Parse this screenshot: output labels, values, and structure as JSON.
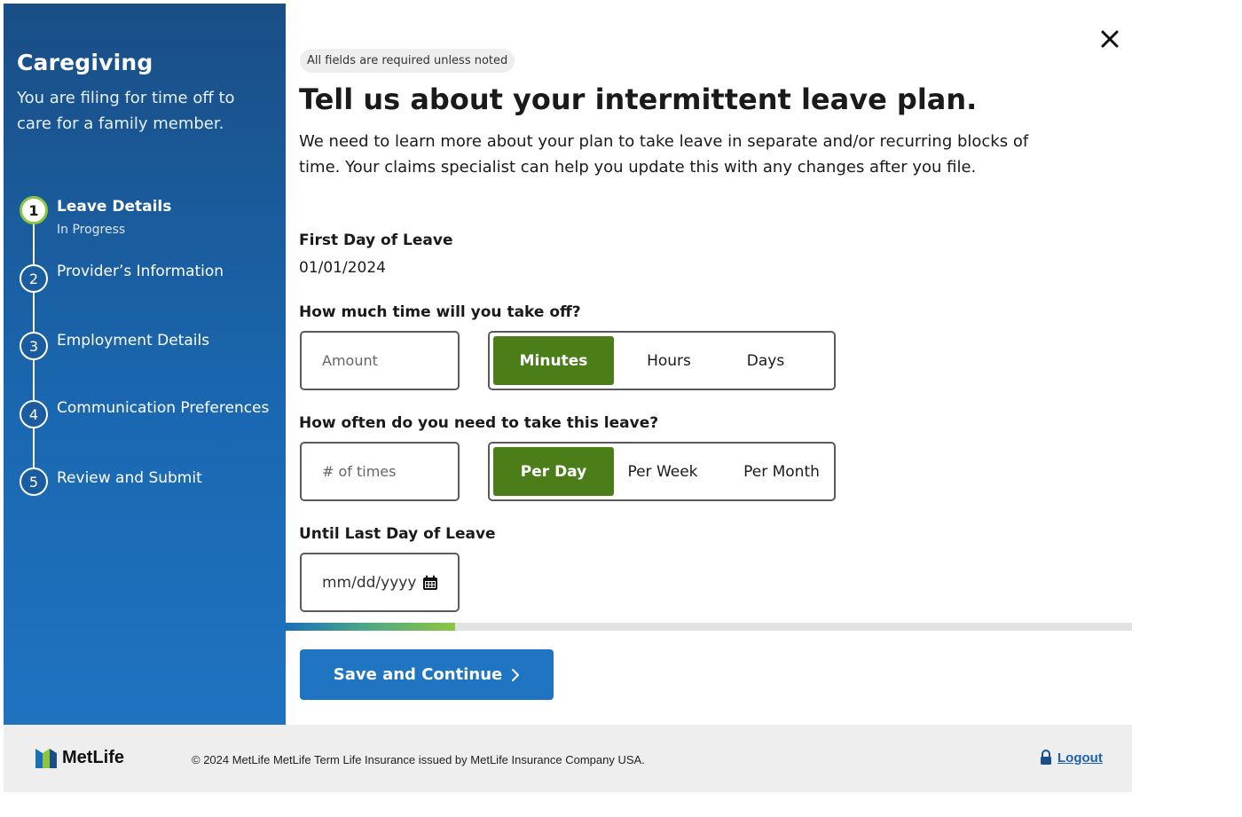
{
  "sidebar": {
    "title": "Caregiving",
    "subtitle": "You are filing for time off to care for a family member.",
    "steps": [
      {
        "number": "1",
        "label": "Leave Details",
        "status": "In Progress",
        "active": true
      },
      {
        "number": "2",
        "label": "Provider’s Information",
        "active": false
      },
      {
        "number": "3",
        "label": "Employment Details",
        "active": false
      },
      {
        "number": "4",
        "label": "Communication Preferences",
        "active": false
      },
      {
        "number": "5",
        "label": "Review and Submit",
        "active": false
      }
    ]
  },
  "main": {
    "required_note": "All fields are required unless noted",
    "title": "Tell us about your intermittent leave plan.",
    "intro": "We need to learn more about your plan to take leave in separate and/or recurring blocks of time. Your claims specialist can help you update this with any changes after you file.",
    "first_day": {
      "label": "First Day of Leave",
      "value": "01/01/2024"
    },
    "time_off": {
      "label": "How much time will you take off?",
      "placeholder": "Amount",
      "options": [
        "Minutes",
        "Hours",
        "Days"
      ],
      "selected": "Minutes"
    },
    "frequency": {
      "label": "How often do you need to take this leave?",
      "placeholder": "# of times",
      "options": [
        "Per Day",
        "Per Week",
        "Per Month"
      ],
      "selected": "Per Day"
    },
    "last_day": {
      "label": "Until Last Day of Leave",
      "placeholder": "mm/dd/yyyy"
    },
    "progress_fraction": 0.2,
    "save_button": "Save and Continue"
  },
  "footer": {
    "brand": "MetLife",
    "copyright": "© 2024 MetLife MetLife Term Life Insurance issued by MetLife Insurance Company USA.",
    "logout": "Logout"
  },
  "colors": {
    "sidebar_top": "#1a4e85",
    "sidebar_bottom": "#1f73c0",
    "selected_green": "#4b7d18",
    "primary_blue": "#1f75c2",
    "progress_green": "#8cc63f"
  },
  "icons": [
    "close-icon",
    "calendar-icon",
    "chevron-right-icon",
    "lock-icon",
    "metlife-logo-icon"
  ]
}
